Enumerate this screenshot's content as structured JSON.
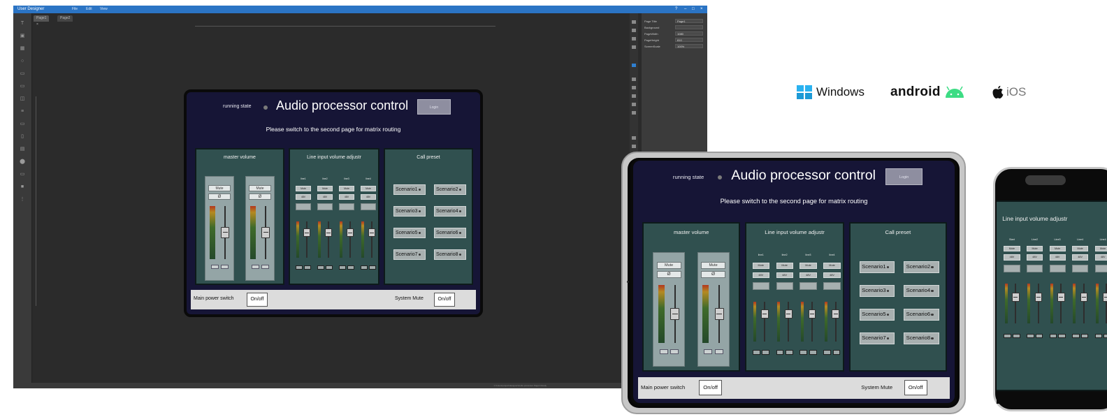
{
  "designer": {
    "app_title": "User Designer",
    "menu": [
      "File",
      "Edit",
      "View"
    ],
    "window_controls": [
      "?",
      "–",
      "□",
      "×"
    ],
    "doc_tabs": [
      "Page1  ×",
      "Page2"
    ],
    "props": [
      {
        "k": "Page Title",
        "v": "Page1"
      },
      {
        "k": "Background",
        "v": ""
      },
      {
        "k": "PageWidth",
        "v": "1080"
      },
      {
        "k": "PageHeight",
        "v": "810"
      },
      {
        "k": "ScreenScale",
        "v": "100%"
      }
    ],
    "status": "C:\\Users\\project\\designer\\Audio processor  Page1  Ready"
  },
  "panel": {
    "running_state": "running state",
    "title": "Audio processor control",
    "login_label": "Login",
    "hint": "Please switch to the second page for matrix routing",
    "master_title": "master volume",
    "line_title": "Line input volume adjustr",
    "preset_title": "Call preset",
    "mute": "Mute",
    "phase": "Ø",
    "line_labels": [
      "line1",
      "line2",
      "line3",
      "line4"
    ],
    "line_short": [
      "Start",
      "Line2",
      "Line3",
      "Line4"
    ],
    "line_mute": "Mute",
    "line_db": "48V",
    "scenarios": [
      "Scenario1",
      "Scenario2",
      "Scenario3",
      "Scenario4",
      "Scenario5",
      "Scenario6",
      "Scenario7",
      "Scenario8"
    ],
    "main_power": "Main power switch",
    "system_mute": "System Mute",
    "onoff": "On/off"
  },
  "platforms": {
    "windows": "Windows",
    "android": "android",
    "ios": "iOS"
  },
  "colors": {
    "panel_bg": "#161536",
    "section_bg": "#30504f",
    "titlebar": "#2b74c4",
    "windows_blue": "#1d9ad6",
    "android_green": "#3ddc84"
  }
}
